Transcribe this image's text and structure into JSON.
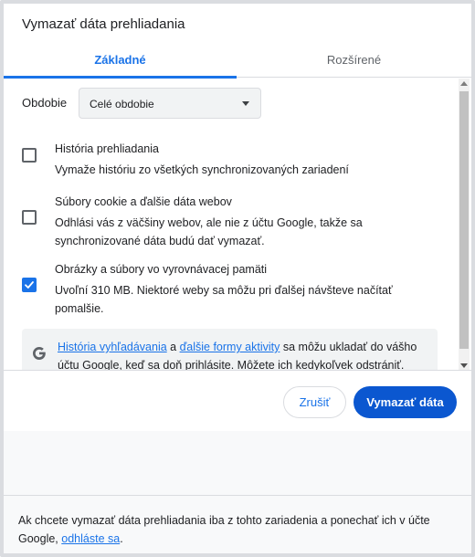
{
  "dialog": {
    "title": "Vymazať dáta prehliadania"
  },
  "tabs": [
    {
      "label": "Základné",
      "active": true
    },
    {
      "label": "Rozšírené",
      "active": false
    }
  ],
  "period": {
    "label": "Obdobie",
    "selected": "Celé obdobie"
  },
  "options": [
    {
      "title": "História prehliadania",
      "description": "Vymaže históriu zo všetkých synchronizovaných zariadení",
      "checked": false
    },
    {
      "title": "Súbory cookie a ďalšie dáta webov",
      "description": "Odhlási vás z väčšiny webov, ale nie z účtu Google, takže sa synchronizované dáta budú dať vymazať.",
      "checked": false
    },
    {
      "title": "Obrázky a súbory vo vyrovnávacej pamäti",
      "description": "Uvoľní 310 MB. Niektoré weby sa môžu pri ďalšej návšteve načítať pomalšie.",
      "checked": true
    }
  ],
  "info": {
    "icon": "google-g-icon",
    "link1": "História vyhľadávania",
    "connector": " a ",
    "link2": "ďalšie formy aktivity",
    "rest": " sa môžu ukladať do vášho účtu Google, keď sa doň prihlásite. Môžete ich kedykoľvek odstrániť."
  },
  "buttons": {
    "cancel": "Zrušiť",
    "clear": "Vymazať dáta"
  },
  "footer": {
    "text": "Ak chcete vymazať dáta prehliadania iba z tohto zariadenia a ponechať ich v účte Google, ",
    "link": "odhláste sa",
    "end": "."
  },
  "colors": {
    "accent": "#1a73e8",
    "primary_button": "#0b57d0"
  }
}
